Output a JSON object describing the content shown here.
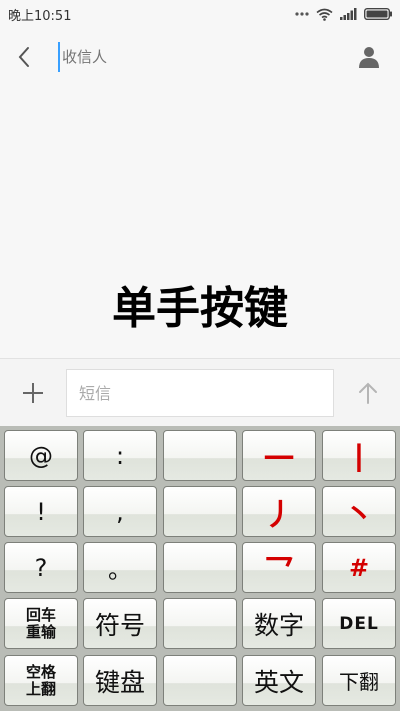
{
  "status_bar": {
    "time": "晚上10:51"
  },
  "header": {
    "recipient_placeholder": "收信人"
  },
  "overlay": {
    "title": "单手按键"
  },
  "compose": {
    "placeholder": "短信"
  },
  "keyboard": {
    "rows": [
      [
        "@",
        ":",
        "",
        "一",
        "丨"
      ],
      [
        "!",
        ",",
        "",
        "丿",
        "丶"
      ],
      [
        "?",
        "。",
        "",
        "乛",
        "#"
      ],
      [
        "回车重输",
        "符号",
        "",
        "数字",
        "DEL"
      ],
      [
        "空格上翻",
        "键盘",
        "",
        "英文",
        "下翻"
      ]
    ],
    "labels": {
      "enter_top": "回车",
      "enter_bottom": "重输",
      "space_top": "空格",
      "space_bottom": "上翻"
    }
  },
  "colors": {
    "stroke_key": "#d40000",
    "cursor": "#39a0ff"
  }
}
